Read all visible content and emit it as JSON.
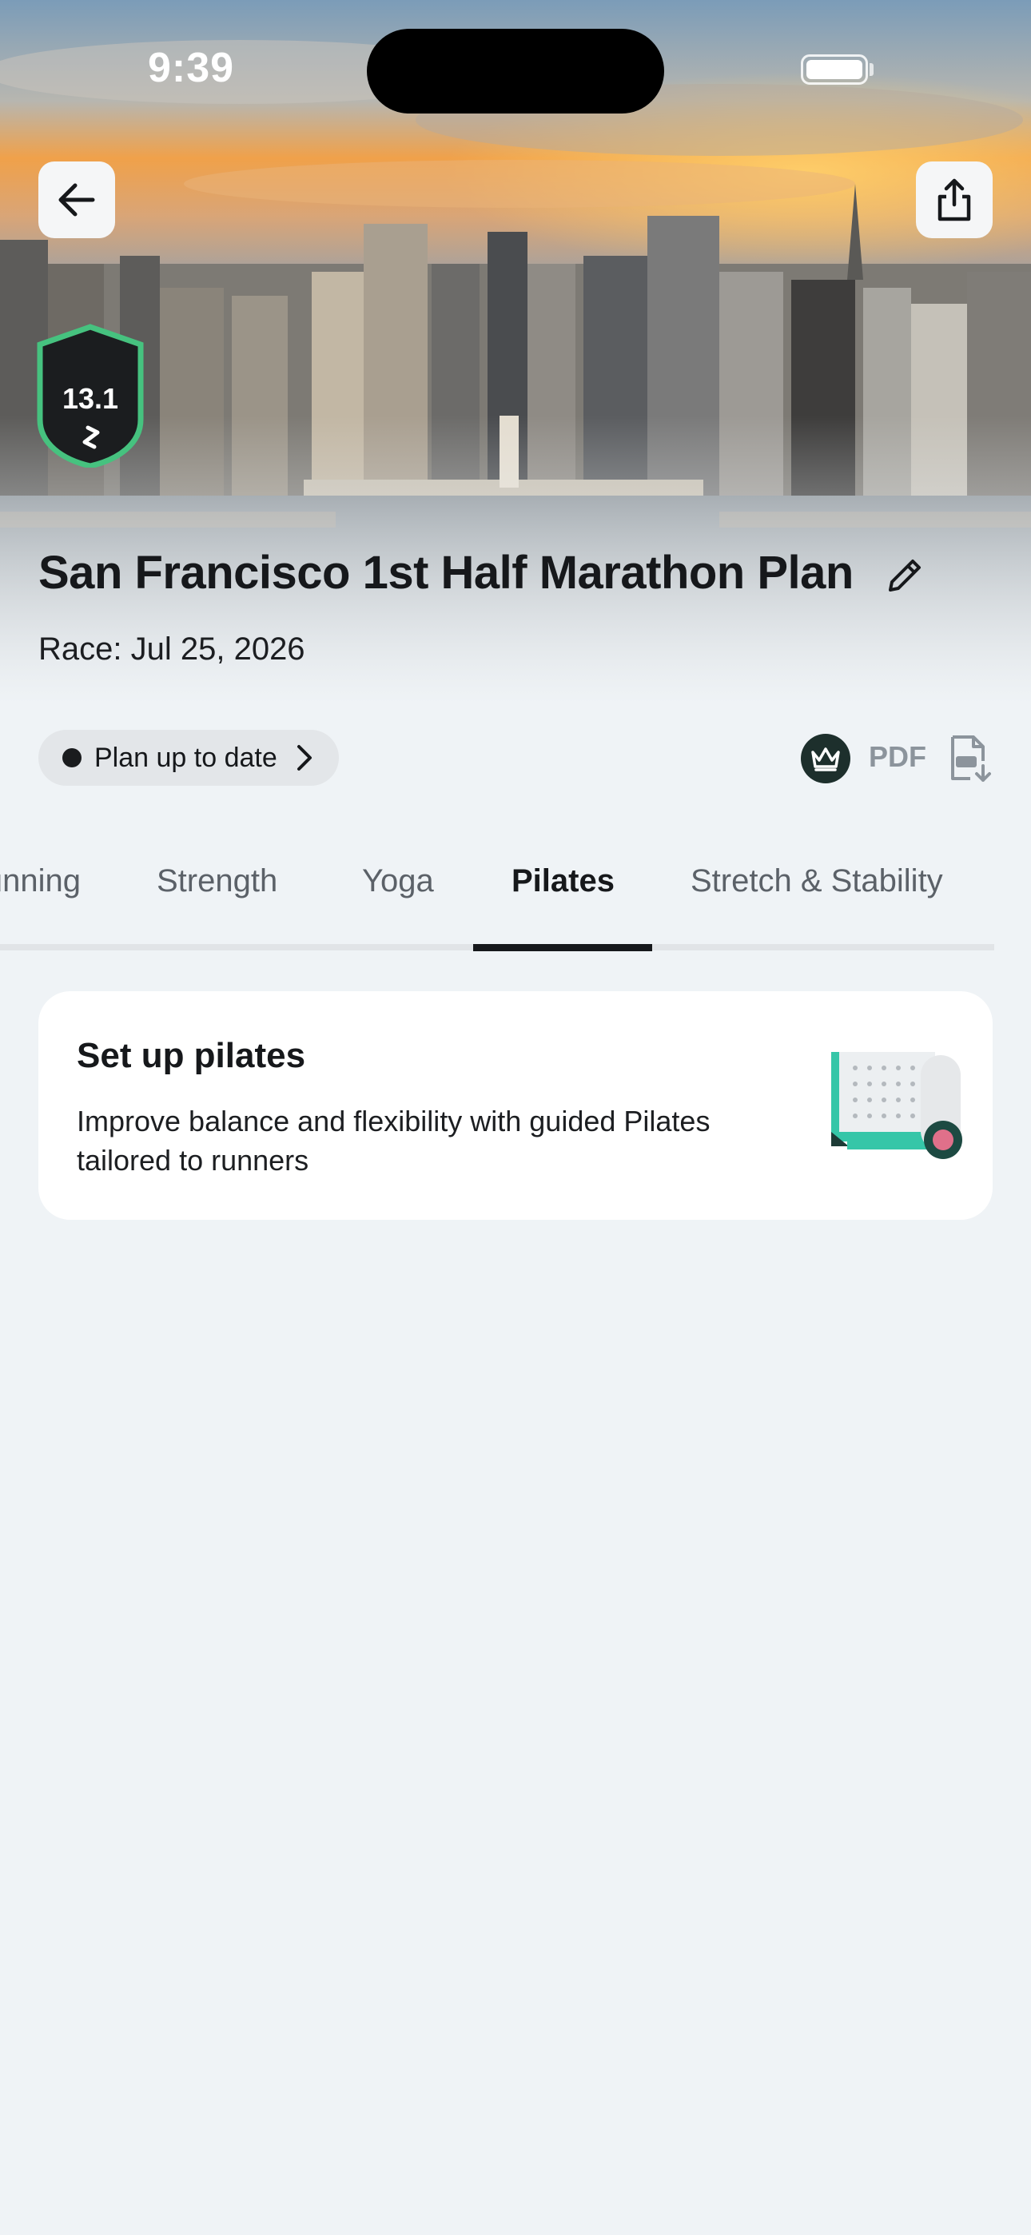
{
  "status_bar": {
    "time": "9:39"
  },
  "header": {
    "badge_distance": "13.1",
    "plan_title": "San Francisco 1st Half Marathon Plan",
    "race_date": "Race: Jul 25, 2026"
  },
  "plan_status": {
    "label": "Plan up to date"
  },
  "export": {
    "pdf_label": "PDF"
  },
  "tabs": [
    {
      "label": "Running"
    },
    {
      "label": "Strength"
    },
    {
      "label": "Yoga"
    },
    {
      "label": "Pilates"
    },
    {
      "label": "Stretch & Stability"
    }
  ],
  "active_tab": "Pilates",
  "card": {
    "title": "Set up pilates",
    "description": "Improve balance and flexibility with guided Pilates tailored to runners"
  },
  "colors": {
    "background": "#eff3f6",
    "text": "#16181b",
    "accent_teal": "#36c6a8",
    "badge_green": "#46c27f",
    "card_bg": "#ffffff"
  }
}
